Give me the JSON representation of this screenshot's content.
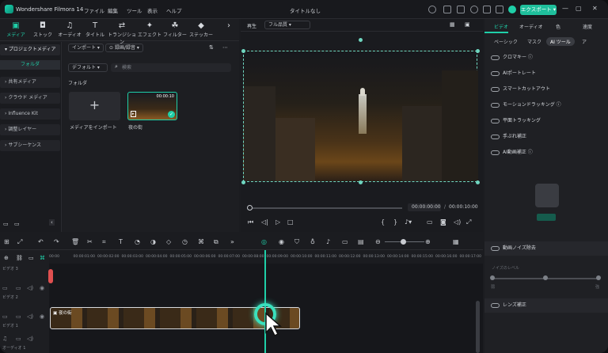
{
  "app": {
    "name": "Wondershare Filmora 14",
    "title": "タイトルなし",
    "export": "エクスポート"
  },
  "menu": [
    "ファイル",
    "編集",
    "ツール",
    "表示",
    "ヘルプ"
  ],
  "toolbar": [
    {
      "label": "メディア",
      "icon": "media-icon"
    },
    {
      "label": "ストック",
      "icon": "stock-icon"
    },
    {
      "label": "オーディオ",
      "icon": "audio-icon"
    },
    {
      "label": "タイトル",
      "icon": "title-icon"
    },
    {
      "label": "トランジション",
      "icon": "transition-icon"
    },
    {
      "label": "エフェクト",
      "icon": "effect-icon"
    },
    {
      "label": "フィルター",
      "icon": "filter-icon"
    },
    {
      "label": "ステッカー",
      "icon": "sticker-icon"
    }
  ],
  "sidebar": {
    "project_media": "プロジェクトメディア",
    "folder": "フォルダ",
    "items": [
      "共有メディア",
      "クラウド メディア",
      "Influence Kit",
      "調整レイヤー",
      "サブシーケンス"
    ]
  },
  "media": {
    "import": "インポート",
    "record": "録画/録音",
    "default": "デフォルト",
    "search_placeholder": "検索",
    "folder_title": "フォルダ",
    "import_media": "メディアをインポート",
    "clip_name": "夜の街",
    "clip_duration": "00:00:10"
  },
  "preview": {
    "tab": "再生",
    "quality": "フル品質",
    "current_time": "00:00:00:00",
    "total_time": "00:00:10:00"
  },
  "right": {
    "tabs": [
      "ビデオ",
      "オーディオ",
      "色",
      "速度"
    ],
    "subtabs": [
      "ベーシック",
      "マスク",
      "AI ツール",
      "ア"
    ],
    "tools": [
      "クロマキー",
      "AIポートレート",
      "スマートカットアウト",
      "モーションドラッキング",
      "平面トラッキング",
      "手ぶれ補正",
      "AI動画補正"
    ],
    "noise": "動画ノイズ除去",
    "noise_level": "ノイズのレベル",
    "weak": "弱",
    "strong": "強",
    "lens": "レンズ補正"
  },
  "timeline": {
    "ruler": [
      "00:00",
      "00:00:01:00",
      "00:00:02:00",
      "00:00:03:00",
      "00:00:04:00",
      "00:00:05:00",
      "00:00:06:00",
      "00:00:07:00",
      "00:00:08:00",
      "00:00:09:00",
      "00:00:10:00",
      "00:00:11:00",
      "00:00:12:00",
      "00:00:13:00",
      "00:00:14:00",
      "00:00:15:00",
      "00:00:16:00",
      "00:00:17:00"
    ],
    "tracks": [
      "ビデオ 3",
      "ビデオ 2",
      "ビデオ 1",
      "オーディオ 1"
    ],
    "clip": "夜の街"
  },
  "colors": {
    "accent": "#1fcfa8"
  }
}
